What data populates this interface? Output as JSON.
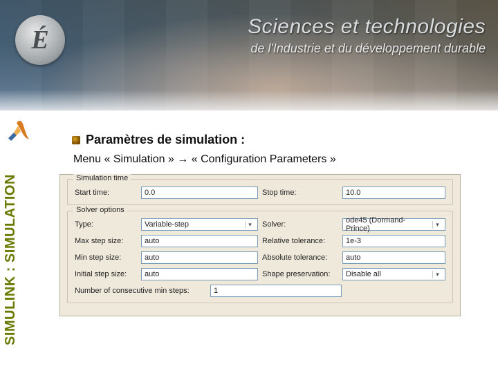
{
  "banner": {
    "badge_letter": "É",
    "title_main": "Sciences et technologies",
    "title_sub": "de l'Industrie et du développement durable"
  },
  "side_label": "SIMULINK : SIMULATION",
  "heading": "Paramètres de simulation :",
  "menu_line": "Menu « Simulation » → « Configuration Parameters »",
  "panel": {
    "group_simtime": {
      "title": "Simulation time",
      "start_lbl": "Start time:",
      "start_val": "0.0",
      "stop_lbl": "Stop time:",
      "stop_val": "10.0"
    },
    "group_solver": {
      "title": "Solver options",
      "type_lbl": "Type:",
      "type_val": "Variable-step",
      "solver_lbl": "Solver:",
      "solver_val": "ode45 (Dormand-Prince)",
      "maxstep_lbl": "Max step size:",
      "maxstep_val": "auto",
      "reltol_lbl": "Relative tolerance:",
      "reltol_val": "1e-3",
      "minstep_lbl": "Min step size:",
      "minstep_val": "auto",
      "abstol_lbl": "Absolute tolerance:",
      "abstol_val": "auto",
      "initstep_lbl": "Initial step size:",
      "initstep_val": "auto",
      "shape_lbl": "Shape preservation:",
      "shape_val": "Disable all",
      "consec_lbl": "Number of consecutive min steps:",
      "consec_val": "1"
    }
  }
}
